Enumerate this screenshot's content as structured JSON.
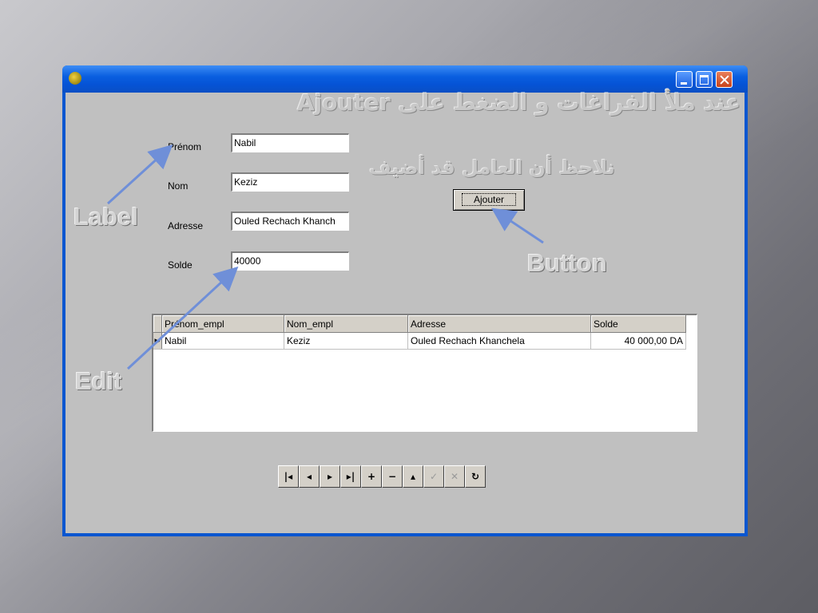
{
  "window": {
    "title": "",
    "controls": [
      "minimize-icon",
      "maximize-icon",
      "close-icon"
    ]
  },
  "annotations": {
    "arabic_instruction": "عند ملأ الفراغات و الضغط على Ajouter",
    "arabic_note": "نلاحظ أن العامل قد أضيف",
    "label": "Label",
    "edit": "Edit",
    "button": "Button"
  },
  "form": {
    "prenom_label": "Prénom",
    "prenom_value": "Nabil",
    "nom_label": "Nom",
    "nom_value": "Keziz",
    "adresse_label": "Adresse",
    "adresse_value": "Ouled Rechach Khanch",
    "solde_label": "Solde",
    "solde_value": "40000",
    "ajouter_label": "Ajouter"
  },
  "grid": {
    "columns": [
      "Prénom_empl",
      "Nom_empl",
      "Adresse",
      "Solde"
    ],
    "rows": [
      [
        "Nabil",
        "Keziz",
        "Ouled Rechach Khanchela",
        "40 000,00 DA"
      ]
    ]
  },
  "navigator": {
    "buttons": [
      {
        "name": "first-record",
        "glyph": "|◂"
      },
      {
        "name": "prior-record",
        "glyph": "◂"
      },
      {
        "name": "next-record",
        "glyph": "▸"
      },
      {
        "name": "last-record",
        "glyph": "▸|"
      },
      {
        "name": "insert-record",
        "glyph": "+"
      },
      {
        "name": "delete-record",
        "glyph": "−"
      },
      {
        "name": "edit-record",
        "glyph": "▴"
      },
      {
        "name": "post-record",
        "glyph": "✓"
      },
      {
        "name": "cancel-record",
        "glyph": "✕"
      },
      {
        "name": "refresh-record",
        "glyph": "↻"
      }
    ]
  }
}
